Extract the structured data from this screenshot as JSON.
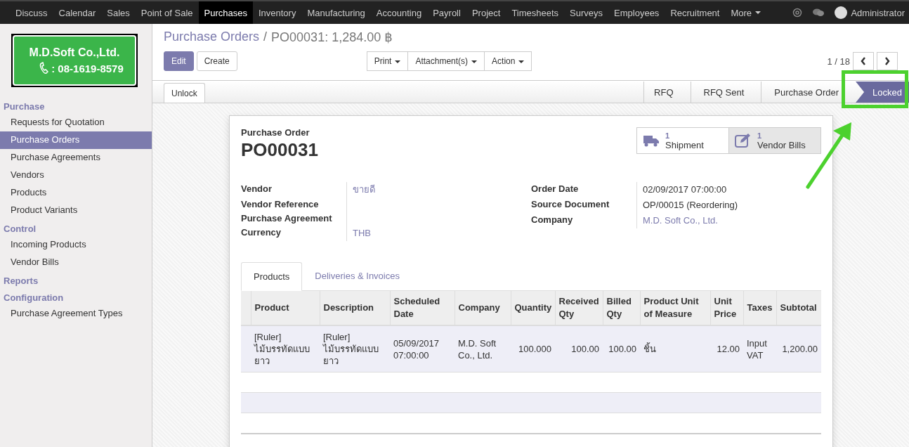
{
  "top_menu": {
    "items": [
      {
        "label": "Discuss",
        "selected": false
      },
      {
        "label": "Calendar",
        "selected": false
      },
      {
        "label": "Sales",
        "selected": false
      },
      {
        "label": "Point of Sale",
        "selected": false
      },
      {
        "label": "Purchases",
        "selected": true
      },
      {
        "label": "Inventory",
        "selected": false
      },
      {
        "label": "Manufacturing",
        "selected": false
      },
      {
        "label": "Accounting",
        "selected": false
      },
      {
        "label": "Payroll",
        "selected": false
      },
      {
        "label": "Project",
        "selected": false
      },
      {
        "label": "Timesheets",
        "selected": false
      },
      {
        "label": "Surveys",
        "selected": false
      },
      {
        "label": "Employees",
        "selected": false
      },
      {
        "label": "Recruitment",
        "selected": false
      }
    ],
    "more": "More",
    "user": "Administrator"
  },
  "logo": {
    "company": "M.D.Soft Co.,Ltd.",
    "phone": ": 08-1619-8579"
  },
  "sidebar": {
    "sections": [
      {
        "title": "Purchase",
        "items": [
          {
            "label": "Requests for Quotation",
            "selected": false
          },
          {
            "label": "Purchase Orders",
            "selected": true
          },
          {
            "label": "Purchase Agreements",
            "selected": false
          },
          {
            "label": "Vendors",
            "selected": false
          },
          {
            "label": "Products",
            "selected": false
          },
          {
            "label": "Product Variants",
            "selected": false
          }
        ]
      },
      {
        "title": "Control",
        "items": [
          {
            "label": "Incoming Products",
            "selected": false
          },
          {
            "label": "Vendor Bills",
            "selected": false
          }
        ]
      },
      {
        "title": "Reports"
      },
      {
        "title": "Configuration",
        "items": [
          {
            "label": "Purchase Agreement Types",
            "selected": false
          }
        ]
      }
    ]
  },
  "breadcrumb": {
    "parent": "Purchase Orders",
    "separator": "/",
    "current": "PO00031: 1,284.00 ฿"
  },
  "buttons": {
    "edit": "Edit",
    "create": "Create",
    "dropdowns": [
      "Print",
      "Attachment(s)",
      "Action"
    ],
    "pager": "1 / 18"
  },
  "statusbar": {
    "unlock": "Unlock",
    "stages": [
      {
        "label": "RFQ",
        "selected": false
      },
      {
        "label": "RFQ Sent",
        "selected": false
      },
      {
        "label": "Purchase Order",
        "selected": false
      },
      {
        "label": "Locked",
        "selected": true
      }
    ]
  },
  "sheet": {
    "caption": "Purchase Order",
    "name": "PO00031",
    "smart_buttons": [
      {
        "kind": "truck",
        "count": "1",
        "label": "Shipment"
      },
      {
        "kind": "pencil",
        "count": "1",
        "label": "Vendor Bills"
      }
    ],
    "left_fields": [
      {
        "label": "Vendor",
        "value": "ขายดี",
        "kind": "link"
      },
      {
        "label": "Vendor Reference",
        "kind": "empty"
      },
      {
        "label": "Purchase Agreement",
        "kind": "empty"
      },
      {
        "label": "Currency",
        "value": "THB",
        "kind": "link"
      }
    ],
    "right_fields": [
      {
        "label": "Order Date",
        "value": "02/09/2017 07:00:00",
        "kind": "text"
      },
      {
        "label": "Source Document",
        "value": "OP/00015 (Reordering)",
        "kind": "text"
      },
      {
        "label": "Company",
        "value": "M.D. Soft Co., Ltd.",
        "kind": "link"
      }
    ],
    "tabs": [
      {
        "label": "Products",
        "selected": true
      },
      {
        "label": "Deliveries & Invoices",
        "selected": false
      }
    ],
    "table": {
      "columns": [
        {
          "label": "Product",
          "kind": "text"
        },
        {
          "label": "Description",
          "kind": "text"
        },
        {
          "label": "Scheduled Date",
          "kind": "text"
        },
        {
          "label": "Company",
          "kind": "text"
        },
        {
          "label": "Quantity",
          "kind": "number"
        },
        {
          "label": "Received Qty",
          "kind": "number"
        },
        {
          "label": "Billed Qty",
          "kind": "number"
        },
        {
          "label": "Product Unit of Measure",
          "kind": "text"
        },
        {
          "label": "Unit Price",
          "kind": "number"
        },
        {
          "label": "Taxes",
          "kind": "text"
        },
        {
          "label": "Subtotal",
          "kind": "number"
        }
      ],
      "rows": [
        [
          "[Ruler] ไม้บรรทัดแบบยาว",
          "[Ruler] ไม้บรรทัดแบบยาว",
          "05/09/2017 07:00:00",
          "M.D. Soft Co., Ltd.",
          "100.000",
          "100.00",
          "100.00",
          "ชิ้น",
          "12.00",
          "Input VAT",
          "1,200.00"
        ]
      ]
    }
  }
}
